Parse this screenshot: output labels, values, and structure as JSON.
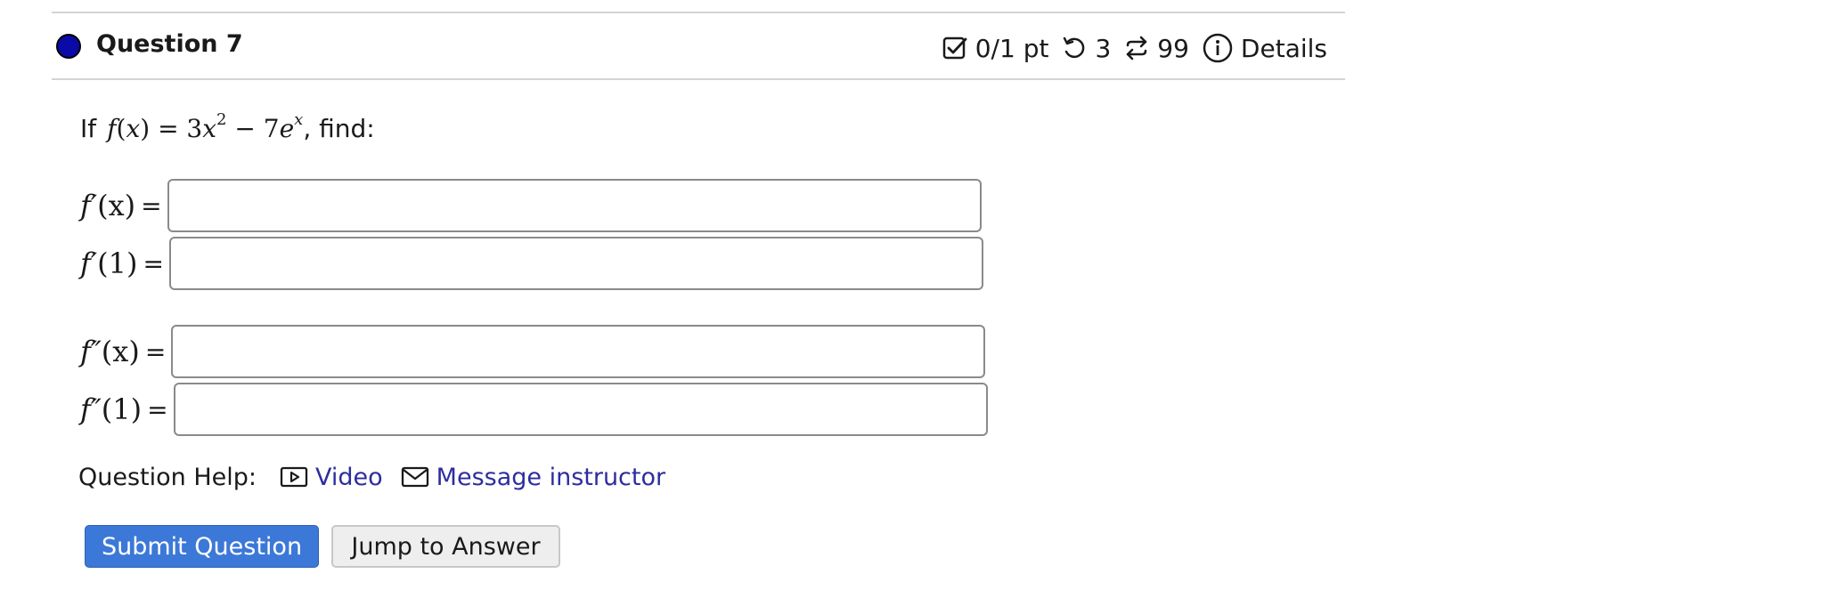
{
  "question": {
    "title": "Question 7",
    "score": "0/1 pt",
    "retries": "3",
    "attempts": "99",
    "details_label": "Details"
  },
  "prompt": {
    "prefix": "If",
    "suffix": ", find:"
  },
  "answers": [
    {
      "label_fn": "f′",
      "label_arg": "(x)",
      "value": "",
      "placeholder": ""
    },
    {
      "label_fn": "f′",
      "label_arg": "(1)",
      "value": "",
      "placeholder": ""
    },
    {
      "label_fn": "f″",
      "label_arg": "(x)",
      "value": "",
      "placeholder": ""
    },
    {
      "label_fn": "f″",
      "label_arg": "(1)",
      "value": "",
      "placeholder": ""
    }
  ],
  "equals": "=",
  "help": {
    "label": "Question Help:",
    "video_label": "Video",
    "message_label": "Message instructor"
  },
  "buttons": {
    "submit": "Submit Question",
    "jump": "Jump to Answer"
  },
  "colors": {
    "status_dot": "#0a0aa8",
    "link": "#2d2d9f",
    "primary_button": "#3c78d8"
  }
}
